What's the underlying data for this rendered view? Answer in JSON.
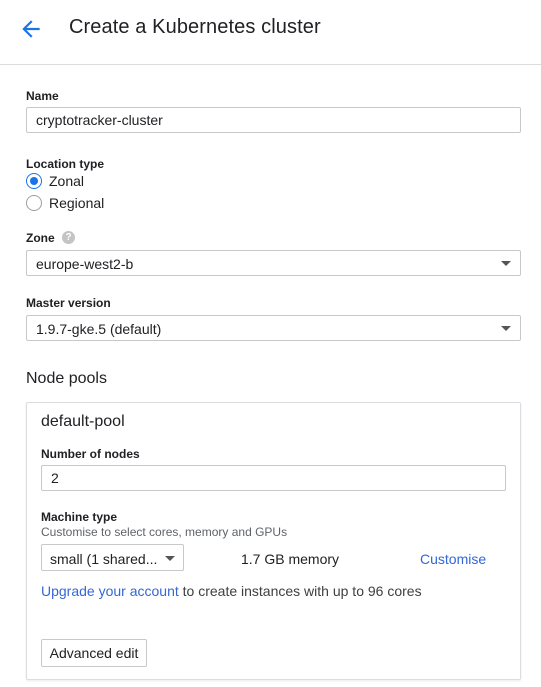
{
  "header": {
    "back_icon": "arrow-left-icon",
    "title": "Create a Kubernetes cluster",
    "accent_color": "#1a73e8"
  },
  "form": {
    "name": {
      "label": "Name",
      "value": "cryptotracker-cluster"
    },
    "location_type": {
      "label": "Location type",
      "options": [
        {
          "label": "Zonal",
          "selected": true
        },
        {
          "label": "Regional",
          "selected": false
        }
      ]
    },
    "zone": {
      "label": "Zone",
      "help_icon": "question-mark-icon",
      "help_glyph": "?",
      "value": "europe-west2-b"
    },
    "master_version": {
      "label": "Master version",
      "value": "1.9.7-gke.5 (default)"
    }
  },
  "node_pools": {
    "title": "Node pools",
    "pool": {
      "name": "default-pool",
      "nodes_label": "Number of nodes",
      "nodes_value": "2",
      "machine_type_label": "Machine type",
      "machine_type_helper": "Customise to select cores, memory and GPUs",
      "machine_type_value": "small (1 shared...",
      "memory": "1.7 GB memory",
      "customise_link": "Customise",
      "upgrade_link": "Upgrade your account",
      "upgrade_rest": " to create instances with up to 96 cores",
      "advanced_edit": "Advanced edit"
    }
  },
  "colors": {
    "link": "#3367d6",
    "radio_selected": "#1a73e8",
    "border": "#c8c8c8"
  }
}
